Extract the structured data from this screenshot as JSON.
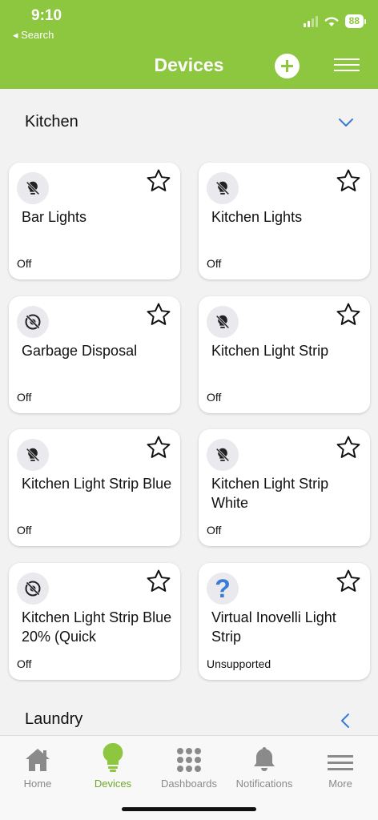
{
  "status_bar": {
    "time": "9:10",
    "back_label": "◂ Search",
    "battery": "88"
  },
  "header": {
    "title": "Devices"
  },
  "sections": [
    {
      "name": "Kitchen"
    },
    {
      "name": "Laundry"
    }
  ],
  "devices": [
    {
      "name": "Bar Lights",
      "status": "Off",
      "icon": "light-off-icon"
    },
    {
      "name": "Kitchen Lights",
      "status": "Off",
      "icon": "light-off-icon"
    },
    {
      "name": "Garbage Disposal",
      "status": "Off",
      "icon": "switch-off-icon"
    },
    {
      "name": "Kitchen Light Strip",
      "status": "Off",
      "icon": "light-off-icon"
    },
    {
      "name": "Kitchen Light Strip Blue",
      "status": "Off",
      "icon": "light-off-icon"
    },
    {
      "name": "Kitchen Light Strip White",
      "status": "Off",
      "icon": "light-off-icon"
    },
    {
      "name": "Kitchen Light Strip Blue 20% (Quick",
      "status": "Off",
      "icon": "switch-off-icon"
    },
    {
      "name": "Virtual Inovelli Light Strip",
      "status": "Unsupported",
      "icon": "question-icon",
      "icon_text": "?"
    }
  ],
  "bottom_nav": [
    {
      "label": "Home",
      "icon": "home-icon"
    },
    {
      "label": "Devices",
      "icon": "bulb-icon",
      "active": true
    },
    {
      "label": "Dashboards",
      "icon": "grid-icon"
    },
    {
      "label": "Notifications",
      "icon": "bell-icon"
    },
    {
      "label": "More",
      "icon": "hamburger-icon"
    }
  ],
  "colors": {
    "accent": "#8dc63f",
    "active_nav": "#6ea82b",
    "chevron": "#3a7bd5"
  }
}
